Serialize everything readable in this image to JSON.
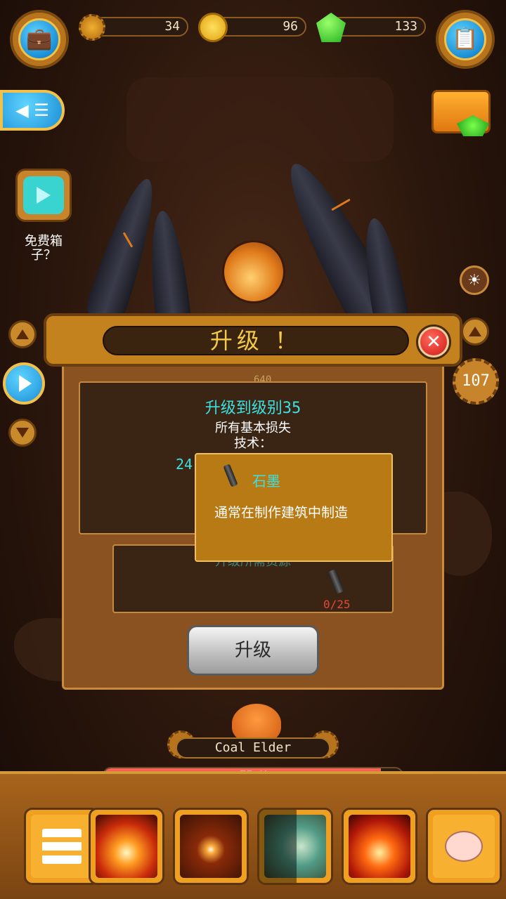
{
  "resources": {
    "gear_count": "34",
    "coin_count": "96",
    "gem_count": "133"
  },
  "left_menu": {
    "free_box_label": "免费箱子？"
  },
  "depth_level": "107",
  "dialog": {
    "title": "升级 ！",
    "upgrade_to": "升级到级别35",
    "description": "所有基本损失\n技术：",
    "partial_value": "24",
    "resources_label": "升级所需资源",
    "resource_progress": "0/25",
    "upgrade_button_label": "升级",
    "partial_top_text": "640"
  },
  "tooltip": {
    "item_name": "石墨",
    "item_description": "通常在制作建筑中制造"
  },
  "boss": {
    "name": "Coal Elder",
    "hp_text": "75 K",
    "hp_fraction": 0.93
  },
  "skills": [
    {
      "name": "fire-beam-skill"
    },
    {
      "name": "bomb-skill"
    },
    {
      "name": "ice-skill"
    },
    {
      "name": "flame-burst-skill"
    }
  ],
  "colors": {
    "accent_gold": "#c4821e",
    "title_text": "#f2c94a",
    "cyan_text": "#3de0e0",
    "hp_red": "#e8342a",
    "resource_red": "#e04a3a"
  }
}
